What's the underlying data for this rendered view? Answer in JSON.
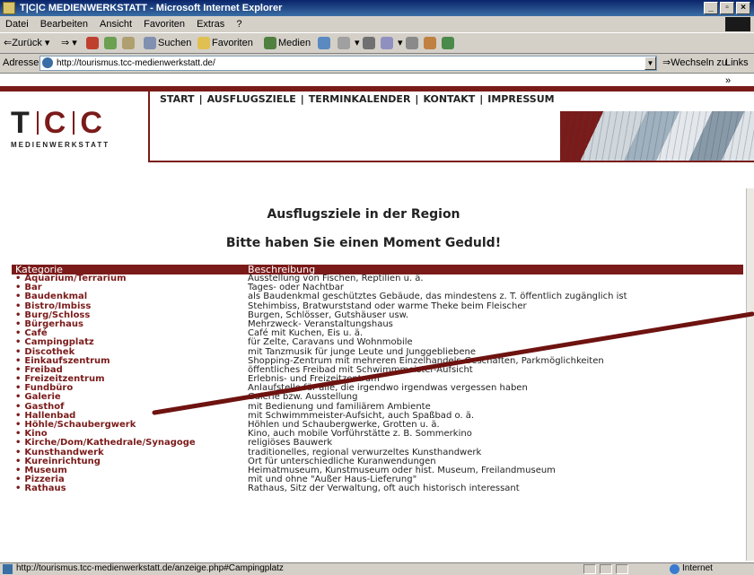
{
  "window": {
    "title": "T|C|C MEDIENWERKSTATT - Microsoft Internet Explorer"
  },
  "menu": [
    "Datei",
    "Bearbeiten",
    "Ansicht",
    "Favoriten",
    "Extras",
    "?"
  ],
  "toolbar": {
    "back": "⇐Zurück",
    "search": "Suchen",
    "favorites": "Favoriten",
    "media": "Medien"
  },
  "address": {
    "label": "Adresse",
    "url": "http://tourismus.tcc-medienwerkstatt.de/",
    "go": "Wechseln zu",
    "links": "Links"
  },
  "logo": {
    "t": "T",
    "c1": "C",
    "c2": "C",
    "sub": "MEDIENWERKSTATT"
  },
  "nav": [
    "START",
    "AUSFLUGSZIELE",
    "TERMINKALENDER",
    "KONTAKT",
    "IMPRESSUM"
  ],
  "content": {
    "heading": "Ausflugsziele in der Region",
    "wait": "Bitte haben Sie einen Moment Geduld!"
  },
  "table": {
    "headers": [
      "Kategorie",
      "Beschreibung"
    ],
    "rows": [
      {
        "cat": "Aquarium/Terrarium",
        "desc": "Ausstellung von Fischen, Reptilien u. ä."
      },
      {
        "cat": "Bar",
        "desc": "Tages- oder Nachtbar"
      },
      {
        "cat": "Baudenkmal",
        "desc": "als Baudenkmal geschütztes Gebäude, das mindestens z. T. öffentlich zugänglich ist"
      },
      {
        "cat": "Bistro/Imbiss",
        "desc": "Stehimbiss, Bratwurststand oder warme Theke beim Fleischer"
      },
      {
        "cat": "Burg/Schloss",
        "desc": "Burgen, Schlösser, Gutshäuser usw."
      },
      {
        "cat": "Bürgerhaus",
        "desc": "Mehrzweck- Veranstaltungshaus"
      },
      {
        "cat": "Café",
        "desc": "Café mit Kuchen, Eis u. ä."
      },
      {
        "cat": "Campingplatz",
        "desc": "für Zelte, Caravans und Wohnmobile"
      },
      {
        "cat": "Discothek",
        "desc": "mit Tanzmusik für junge Leute und Junggebliebene"
      },
      {
        "cat": "Einkaufszentrum",
        "desc": "Shopping-Zentrum mit mehreren Einzelhandels-Geschäften, Parkmöglichkeiten"
      },
      {
        "cat": "Freibad",
        "desc": "öffentliches Freibad mit Schwimmmeister-Aufsicht"
      },
      {
        "cat": "Freizeitzentrum",
        "desc": "Erlebnis- und Freizeitzentrum"
      },
      {
        "cat": "Fundbüro",
        "desc": "Anlaufstelle für alle, die irgendwo irgendwas vergessen haben"
      },
      {
        "cat": "Galerie",
        "desc": "Galerie bzw. Ausstellung"
      },
      {
        "cat": "Gasthof",
        "desc": "mit Bedienung und familiärem Ambiente"
      },
      {
        "cat": "Hallenbad",
        "desc": "mit Schwimmmeister-Aufsicht, auch Spaßbad o. ä."
      },
      {
        "cat": "Höhle/Schaubergwerk",
        "desc": "Höhlen und Schaubergwerke, Grotten u. ä."
      },
      {
        "cat": "Kino",
        "desc": "Kino, auch mobile Vorführstätte z. B. Sommerkino"
      },
      {
        "cat": "Kirche/Dom/Kathedrale/Synagoge",
        "desc": "religiöses Bauwerk"
      },
      {
        "cat": "Kunsthandwerk",
        "desc": "traditionelles, regional verwurzeltes Kunsthandwerk"
      },
      {
        "cat": "Kureinrichtung",
        "desc": "Ort für unterschiedliche Kuranwendungen"
      },
      {
        "cat": "Museum",
        "desc": "Heimatmuseum, Kunstmuseum oder hist. Museum, Freilandmuseum"
      },
      {
        "cat": "Pizzeria",
        "desc": "mit und ohne \"Außer Haus-Lieferung\""
      },
      {
        "cat": "Rathaus",
        "desc": "Rathaus, Sitz der Verwaltung, oft auch historisch interessant"
      }
    ]
  },
  "status": {
    "url": "http://tourismus.tcc-medienwerkstatt.de/anzeige.php#Campingplatz",
    "zone": "Internet"
  },
  "colors": {
    "brand": "#7a1b1a",
    "chrome": "#d4d0c8",
    "titlebar": "#0a246a"
  }
}
